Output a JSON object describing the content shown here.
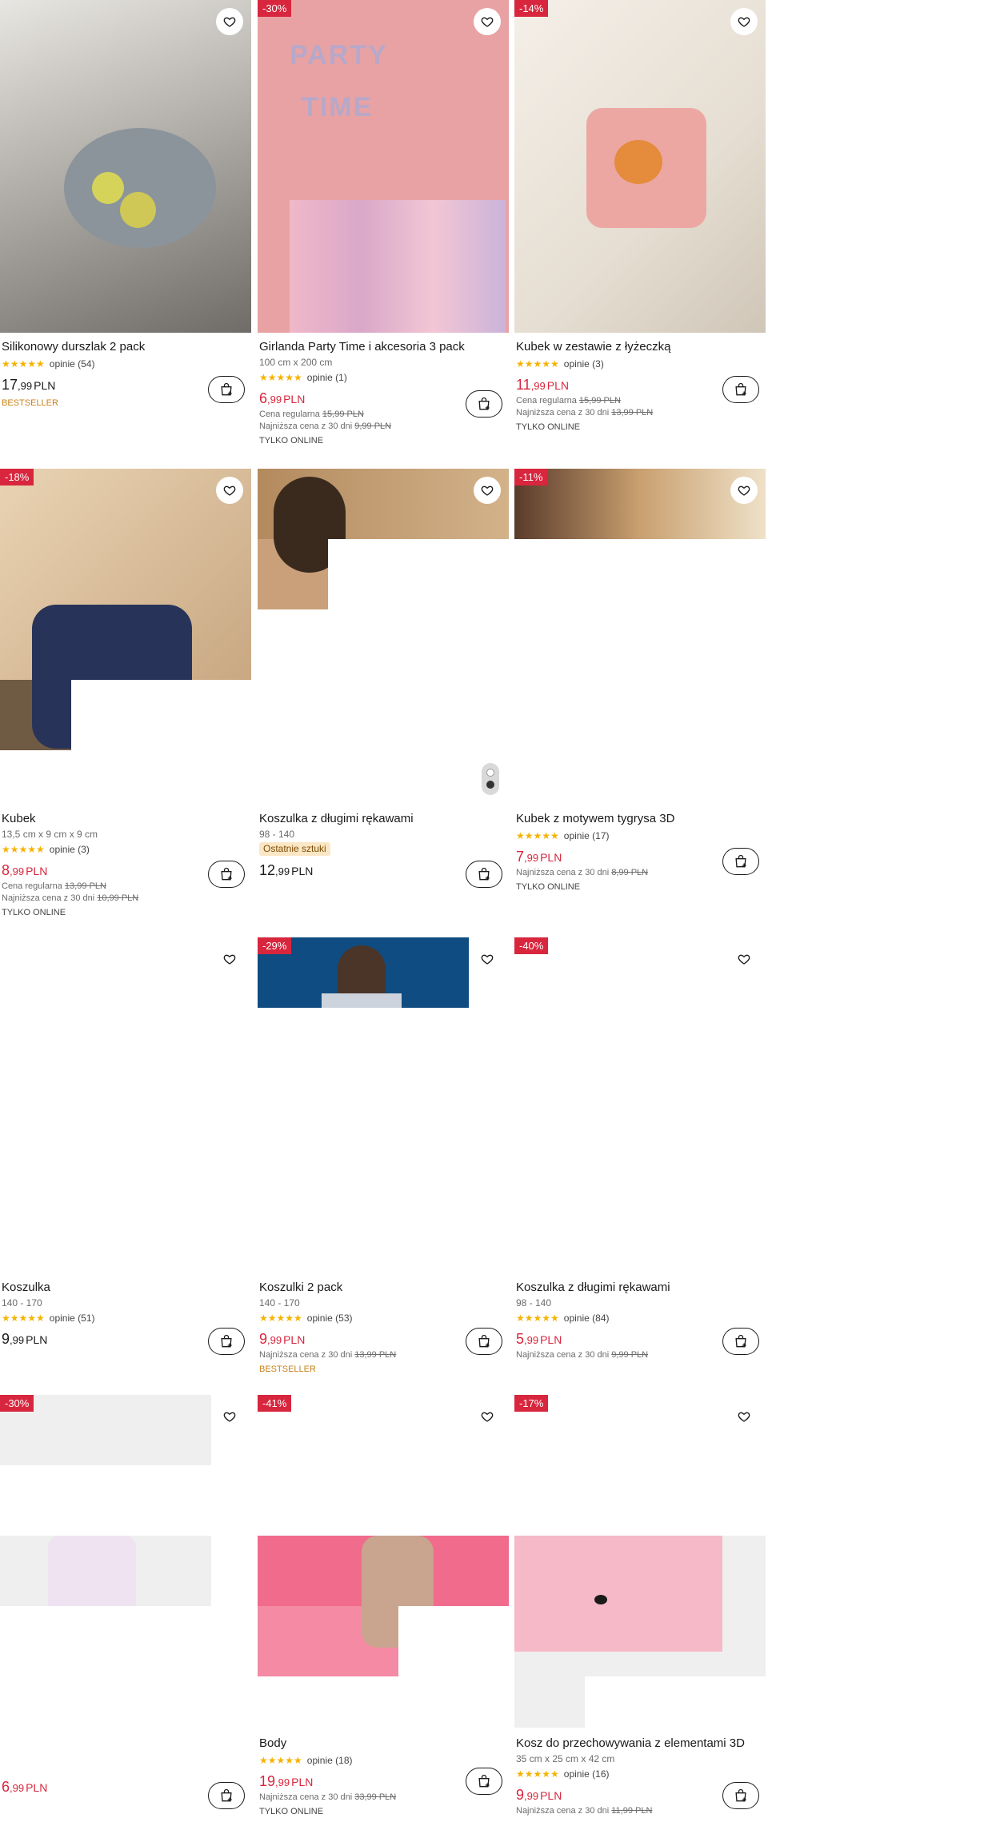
{
  "products": [
    {
      "name": "Silikonowy durszlak 2 pack",
      "size": "",
      "rating_text": "opinie (54)",
      "stars": "★★★★★",
      "price_int": "17",
      "price_dec": ",99",
      "currency": "PLN",
      "regular_label": "",
      "regular_price": "",
      "lowest_label": "",
      "lowest_price": "",
      "tag": "BESTSELLER",
      "badge": ""
    },
    {
      "name": "Girlanda Party Time i akcesoria 3 pack",
      "size": "100 cm x 200 cm",
      "rating_text": "opinie (1)",
      "stars": "★★★★★",
      "price_int": "6",
      "price_dec": ",99",
      "currency": "PLN",
      "regular_label": "Cena regularna",
      "regular_price": "15,99 PLN",
      "lowest_label": "Najniższa cena z 30 dni",
      "lowest_price": "9,99 PLN",
      "tag": "TYLKO ONLINE",
      "badge": "-30%"
    },
    {
      "name": "Kubek w zestawie z łyżeczką",
      "size": "",
      "rating_text": "opinie (3)",
      "stars": "★★★★★",
      "price_int": "11",
      "price_dec": ",99",
      "currency": "PLN",
      "regular_label": "Cena regularna",
      "regular_price": "15,99 PLN",
      "lowest_label": "Najniższa cena z 30 dni",
      "lowest_price": "13,99 PLN",
      "tag": "TYLKO ONLINE",
      "badge": "-14%"
    },
    {
      "name": "Kubek",
      "size": "13,5 cm x 9 cm x 9 cm",
      "rating_text": "opinie (3)",
      "stars": "★★★★★",
      "price_int": "8",
      "price_dec": ",99",
      "currency": "PLN",
      "regular_label": "Cena regularna",
      "regular_price": "13,99 PLN",
      "lowest_label": "Najniższa cena z 30 dni",
      "lowest_price": "10,99 PLN",
      "tag": "TYLKO ONLINE",
      "badge": "-18%"
    },
    {
      "name": "Koszulka z długimi rękawami",
      "size": "98 - 140",
      "rating_text": "",
      "stars": "",
      "price_int": "12",
      "price_dec": ",99",
      "currency": "PLN",
      "regular_label": "",
      "regular_price": "",
      "lowest_label": "",
      "lowest_price": "",
      "tag": "Ostatnie sztuki",
      "badge": ""
    },
    {
      "name": "Kubek z motywem tygrysa 3D",
      "size": "",
      "rating_text": "opinie (17)",
      "stars": "★★★★★",
      "price_int": "7",
      "price_dec": ",99",
      "currency": "PLN",
      "regular_label": "",
      "regular_price": "",
      "lowest_label": "Najniższa cena z 30 dni",
      "lowest_price": "8,99 PLN",
      "tag": "TYLKO ONLINE",
      "badge": "-11%"
    },
    {
      "name": "Koszulka",
      "size": "140 - 170",
      "rating_text": "opinie (51)",
      "stars": "★★★★★",
      "price_int": "9",
      "price_dec": ",99",
      "currency": "PLN",
      "regular_label": "",
      "regular_price": "",
      "lowest_label": "",
      "lowest_price": "",
      "tag": "",
      "badge": ""
    },
    {
      "name": "Koszulki 2 pack",
      "size": "140 - 170",
      "rating_text": "opinie (53)",
      "stars": "★★★★★",
      "price_int": "9",
      "price_dec": ",99",
      "currency": "PLN",
      "regular_label": "",
      "regular_price": "",
      "lowest_label": "Najniższa cena z 30 dni",
      "lowest_price": "13,99 PLN",
      "tag": "BESTSELLER",
      "badge": "-29%"
    },
    {
      "name": "Koszulka z długimi rękawami",
      "size": "98 - 140",
      "rating_text": "opinie (84)",
      "stars": "★★★★★",
      "price_int": "5",
      "price_dec": ",99",
      "currency": "PLN",
      "regular_label": "",
      "regular_price": "",
      "lowest_label": "Najniższa cena z 30 dni",
      "lowest_price": "9,99 PLN",
      "tag": "",
      "badge": "-40%"
    },
    {
      "name": "",
      "size": "",
      "rating_text": "",
      "stars": "",
      "price_int": "6",
      "price_dec": ",99",
      "currency": "PLN",
      "regular_label": "",
      "regular_price": "",
      "lowest_label": "",
      "lowest_price": "",
      "tag": "",
      "badge": "-30%"
    },
    {
      "name": "Body",
      "size": "",
      "rating_text": "opinie (18)",
      "stars": "★★★★★",
      "price_int": "19",
      "price_dec": ",99",
      "currency": "PLN",
      "regular_label": "",
      "regular_price": "",
      "lowest_label": "Najniższa cena z 30 dni",
      "lowest_price": "33,99 PLN",
      "tag": "TYLKO ONLINE",
      "badge": "-41%"
    },
    {
      "name": "Kosz do przechowywania z elementami 3D",
      "size": "35 cm x 25 cm x 42 cm",
      "rating_text": "opinie (16)",
      "stars": "★★★★★",
      "price_int": "9",
      "price_dec": ",99",
      "currency": "PLN",
      "regular_label": "",
      "regular_price": "",
      "lowest_label": "Najniższa cena z 30 dni",
      "lowest_price": "11,99 PLN",
      "tag": "",
      "badge": "-17%"
    }
  ],
  "colors": {
    "sale_red": "#d7263d",
    "bestseller_orange": "#c9821a",
    "star_yellow": "#f5b301",
    "last_pieces_bg": "#fbe7c6"
  },
  "icons": {
    "wishlist": "heart-icon",
    "cart": "add-to-cart-icon"
  }
}
